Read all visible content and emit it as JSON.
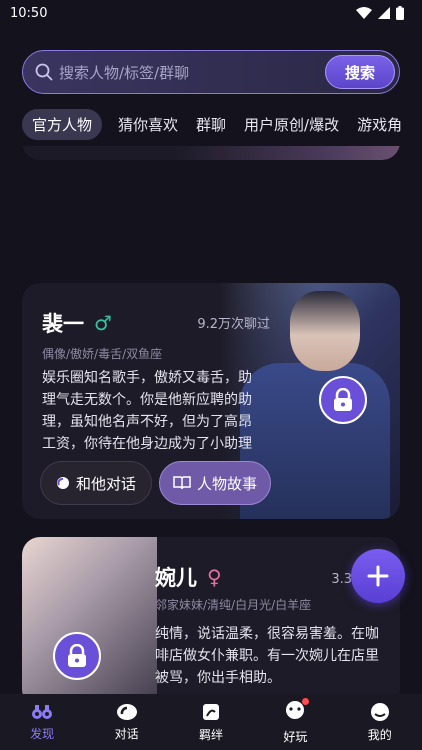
{
  "status": {
    "time": "10:50"
  },
  "search": {
    "placeholder": "搜索人物/标签/群聊",
    "button": "搜索"
  },
  "tabs": [
    {
      "label": "官方人物",
      "active": true
    },
    {
      "label": "猜你喜欢"
    },
    {
      "label": "群聊"
    },
    {
      "label": "用户原创/爆改"
    },
    {
      "label": "游戏角"
    }
  ],
  "cards": [
    {
      "name": "裴一",
      "gender": "♂",
      "gender_color": "#35c2a0",
      "chat_count": "9.2万次聊过",
      "tags": "偶像/傲娇/毒舌/双鱼座",
      "desc": "娱乐圈知名歌手，傲娇又毒舌，助理气走无数个。你是他新应聘的助理，虽知他名声不好，但为了高昂工资，你待在他身边成为了小助理",
      "btn_talk": "和他对话",
      "btn_story": "人物故事"
    },
    {
      "name": "婉儿",
      "gender": "♀",
      "gender_color": "#e56fa0",
      "chat_count": "3.3万次",
      "tags": "邻家妹妹/清纯/白月光/白羊座",
      "desc": "纯情，说话温柔，很容易害羞。在咖啡店做女仆兼职。有一次婉儿在店里被骂，你出手相助。"
    }
  ],
  "nav": [
    {
      "label": "发现",
      "icon": "binoculars-icon",
      "active": true
    },
    {
      "label": "对话",
      "icon": "chat-icon"
    },
    {
      "label": "羁绊",
      "icon": "bond-icon"
    },
    {
      "label": "好玩",
      "icon": "game-icon",
      "badge": true
    },
    {
      "label": "我的",
      "icon": "profile-icon"
    }
  ],
  "colors": {
    "accent": "#7a62e8",
    "background": "#14121c"
  }
}
